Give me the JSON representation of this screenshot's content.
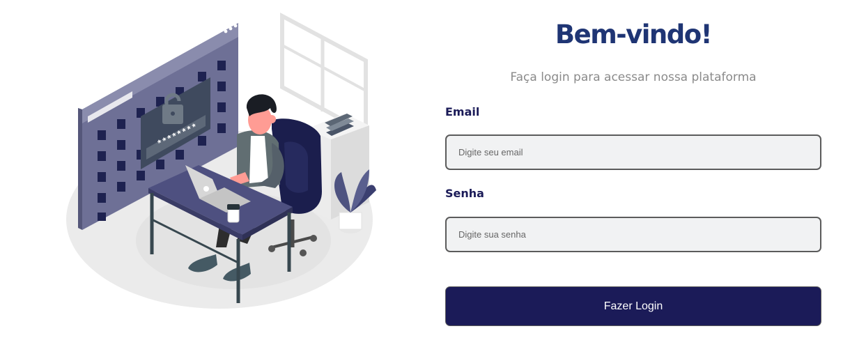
{
  "illustration": {
    "password_mask": "********"
  },
  "login": {
    "title": "Bem-vindo!",
    "subtitle": "Faça login para acessar nossa plataforma",
    "email_label": "Email",
    "email_placeholder": "Digite seu email",
    "password_label": "Senha",
    "password_placeholder": "Digite sua senha",
    "submit_label": "Fazer Login"
  },
  "colors": {
    "title": "#1f3574",
    "label": "#1b1b58",
    "button": "#1b1b58",
    "subtitle": "#8a8a8a",
    "input_bg": "#f1f2f3"
  }
}
